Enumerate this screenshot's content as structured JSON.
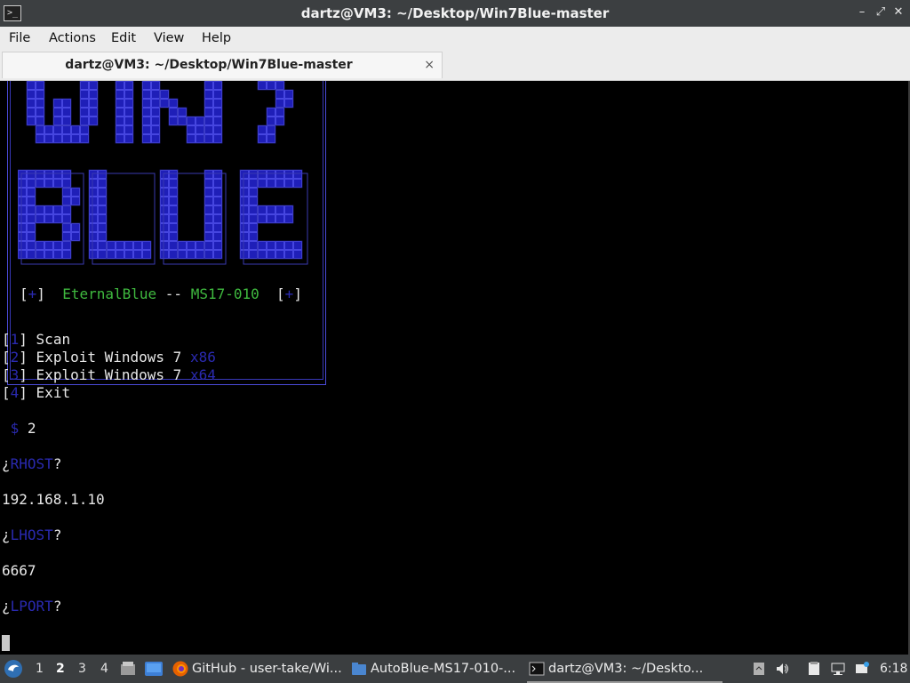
{
  "window": {
    "title": "dartz@VM3: ~/Desktop/Win7Blue-master",
    "app_icon_glyph": ">_"
  },
  "menu": [
    "File",
    "Actions",
    "Edit",
    "View",
    "Help"
  ],
  "tab": {
    "label": "dartz@VM3: ~/Desktop/Win7Blue-master",
    "close_glyph": "×"
  },
  "banner": {
    "bracket_open": "[",
    "plus": "+",
    "bracket_close": "]",
    "name": "EternalBlue",
    "sep": "--",
    "code": "MS17-010"
  },
  "options": [
    {
      "num": "1",
      "label": "Scan",
      "arch": ""
    },
    {
      "num": "2",
      "label": "Exploit Windows 7",
      "arch": "x86"
    },
    {
      "num": "3",
      "label": "Exploit Windows 7",
      "arch": "x64"
    },
    {
      "num": "4",
      "label": "Exit",
      "arch": ""
    }
  ],
  "prompt": {
    "symbol": "$",
    "input": "2"
  },
  "rhost": {
    "prefix": "¿",
    "label": "RHOST",
    "suffix": "?",
    "value": "192.168.1.10"
  },
  "lhost": {
    "prefix": "¿",
    "label": "LHOST",
    "suffix": "?",
    "value": "6667"
  },
  "lport": {
    "prefix": "¿",
    "label": "LPORT",
    "suffix": "?"
  },
  "taskbar": {
    "workspaces": [
      "1",
      "2",
      "3",
      "4"
    ],
    "active_workspace": "2",
    "tasks": [
      {
        "label": "GitHub - user-take/Wi...",
        "icon": "firefox-icon"
      },
      {
        "label": "AutoBlue-MS17-010-...",
        "icon": "folder-icon"
      },
      {
        "label": "dartz@VM3: ~/Deskto...",
        "icon": "terminal-icon"
      }
    ],
    "clock": "6:18"
  },
  "colors": {
    "titlebar": "#3c3f41",
    "menubar": "#ececec",
    "terminal_bg": "#000000",
    "banner_blue": "#2020c0",
    "banner_green": "#3fb93f",
    "taskbar": "#3b3e40"
  }
}
